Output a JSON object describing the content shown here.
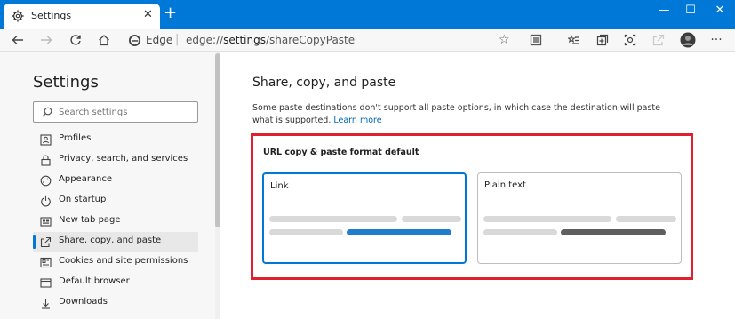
{
  "window": {
    "tab_title": "Settings",
    "tab_icon": "gear-icon",
    "new_tab": "+",
    "minimize": "—",
    "maximize": "☐",
    "close": "✕"
  },
  "toolbar": {
    "brand": "Edge",
    "url_prefix": "edge://",
    "url_host": "settings",
    "url_path": "/shareCopyPaste"
  },
  "sidebar": {
    "title": "Settings",
    "search_placeholder": "Search settings",
    "items": [
      {
        "label": "Profiles",
        "icon": "profile-icon"
      },
      {
        "label": "Privacy, search, and services",
        "icon": "lock-icon"
      },
      {
        "label": "Appearance",
        "icon": "appearance-icon"
      },
      {
        "label": "On startup",
        "icon": "power-icon"
      },
      {
        "label": "New tab page",
        "icon": "new-tab-page-icon"
      },
      {
        "label": "Share, copy, and paste",
        "icon": "share-icon",
        "active": true
      },
      {
        "label": "Cookies and site permissions",
        "icon": "cookies-icon"
      },
      {
        "label": "Default browser",
        "icon": "default-browser-icon"
      },
      {
        "label": "Downloads",
        "icon": "download-icon"
      }
    ]
  },
  "main": {
    "title": "Share, copy, and paste",
    "description": "Some paste destinations don't support all paste options, in which case the destination will paste what is supported.",
    "learn_more": "Learn more",
    "section_label": "URL copy & paste format default",
    "options": [
      {
        "label": "Link",
        "selected": true
      },
      {
        "label": "Plain text",
        "selected": false
      }
    ]
  },
  "colors": {
    "accent": "#0078d7",
    "highlight_border": "#e0202e",
    "link_bar": "#1f7dcc",
    "plaintext_bar": "#5f5f5f",
    "placeholder_bar": "#d9d9d9"
  }
}
